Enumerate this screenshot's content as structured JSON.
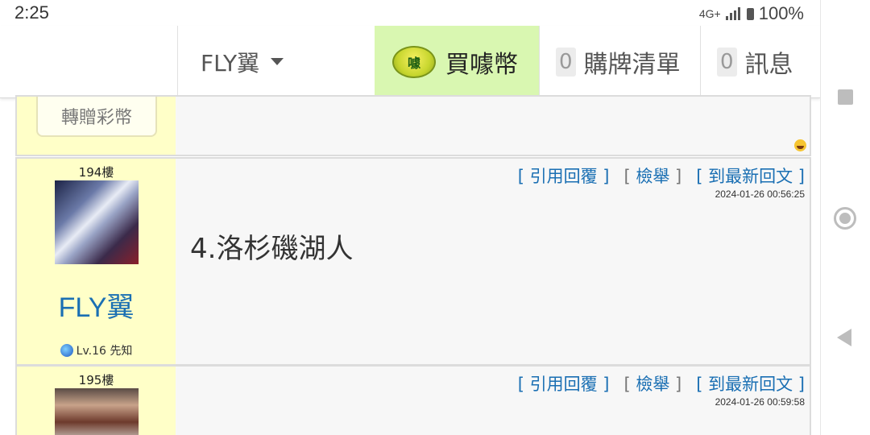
{
  "status_bar": {
    "time": "2:25",
    "network": "4G+",
    "battery": "100%"
  },
  "nav": {
    "user": "FLY翼",
    "buy_coins": "買噱幣",
    "coin_badge": "噱",
    "cart_count": "0",
    "cart_label": "購牌清單",
    "msg_count": "0",
    "msg_label": "訊息"
  },
  "prev_post": {
    "gift_button": "轉贈彩幣"
  },
  "posts": [
    {
      "floor": "194樓",
      "username": "FLY翼",
      "level": "Lv.16 先知",
      "actions": {
        "quote": "引用回覆",
        "report": "檢舉",
        "latest": "到最新回文"
      },
      "timestamp": "2024-01-26 00:56:25",
      "text": "4.洛杉磯湖人"
    },
    {
      "floor": "195樓",
      "actions": {
        "quote": "引用回覆",
        "report": "檢舉",
        "latest": "到最新回文"
      },
      "timestamp": "2024-01-26 00:59:58"
    }
  ],
  "colors": {
    "link": "#1a6fb3",
    "sidebar_bg": "#ffffc8",
    "buy_bg": "#d9f7b1"
  }
}
